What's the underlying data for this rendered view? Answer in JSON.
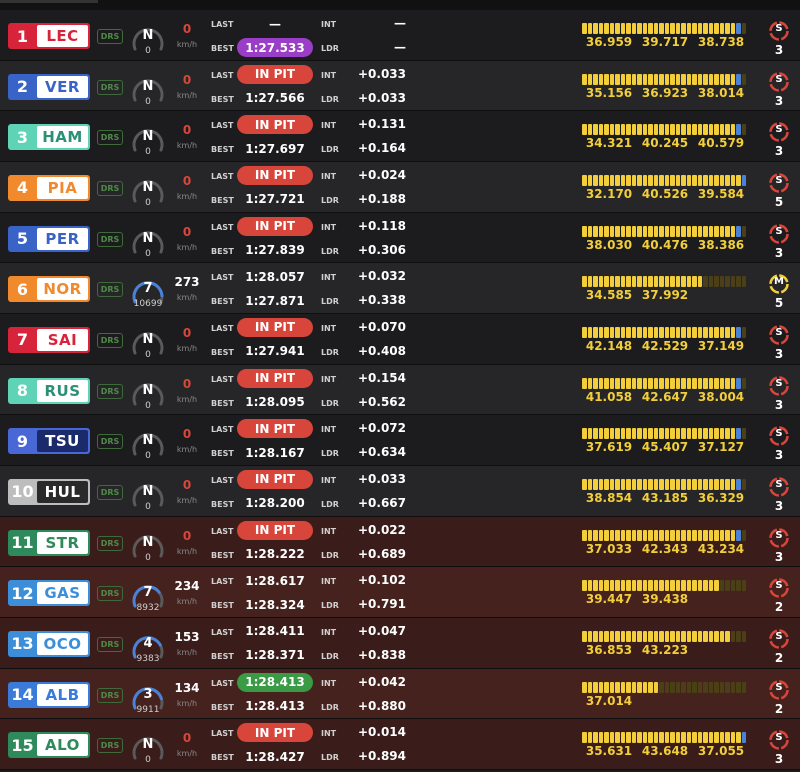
{
  "labels": {
    "drs": "DRS",
    "kmh": "km/h",
    "last": "LAST",
    "best": "BEST",
    "int": "INT",
    "ldr": "LDR"
  },
  "colors": {
    "yellow": "#f2cf3a",
    "yellow_dim": "#4a3f16",
    "blue": "#4a82d9",
    "grey_dim": "#3a3a3a",
    "pit": "#d8453a",
    "purple": "#9a3dc7",
    "green": "#3a9a45"
  },
  "drivers": [
    {
      "pos": "1",
      "code": "LEC",
      "team_color": "#d8243a",
      "code_text": "#d8243a",
      "gear": "N",
      "rpm": "0",
      "speed": "0",
      "last": "—",
      "last_style": "plain",
      "best": "1:27.533",
      "best_style": "purple",
      "int": "—",
      "ldr": "—",
      "minisector_progress": 0.97,
      "minisector_style": "yellow",
      "s1": "36.959",
      "s2": "39.717",
      "s3": "38.738",
      "tyre_compound": "S",
      "tyre_color": "#d8453a",
      "tyre_laps": "3",
      "zone": "normal"
    },
    {
      "pos": "2",
      "code": "VER",
      "team_color": "#3a63c7",
      "code_text": "#3a63c7",
      "gear": "N",
      "rpm": "0",
      "speed": "0",
      "last": "IN PIT",
      "last_style": "pit",
      "best": "1:27.566",
      "best_style": "plain",
      "int": "+0.033",
      "ldr": "+0.033",
      "minisector_progress": 0.97,
      "minisector_style": "yellow",
      "s1": "35.156",
      "s2": "36.923",
      "s3": "38.014",
      "tyre_compound": "S",
      "tyre_color": "#d8453a",
      "tyre_laps": "3",
      "zone": "normal"
    },
    {
      "pos": "3",
      "code": "HAM",
      "team_color": "#5ed3b6",
      "code_text": "#2c8f78",
      "gear": "N",
      "rpm": "0",
      "speed": "0",
      "last": "IN PIT",
      "last_style": "pit",
      "best": "1:27.697",
      "best_style": "plain",
      "int": "+0.131",
      "ldr": "+0.164",
      "minisector_progress": 0.97,
      "minisector_style": "yellow",
      "s1": "34.321",
      "s2": "40.245",
      "s3": "40.579",
      "tyre_compound": "S",
      "tyre_color": "#d8453a",
      "tyre_laps": "3",
      "zone": "normal"
    },
    {
      "pos": "4",
      "code": "PIA",
      "team_color": "#f08a2c",
      "code_text": "#f08a2c",
      "gear": "N",
      "rpm": "0",
      "speed": "0",
      "last": "IN PIT",
      "last_style": "pit",
      "best": "1:27.721",
      "best_style": "plain",
      "int": "+0.024",
      "ldr": "+0.188",
      "minisector_progress": 1.0,
      "minisector_style": "yellow",
      "s1": "32.170",
      "s2": "40.526",
      "s3": "39.584",
      "tyre_compound": "S",
      "tyre_color": "#d8453a",
      "tyre_laps": "5",
      "zone": "normal"
    },
    {
      "pos": "5",
      "code": "PER",
      "team_color": "#3a63c7",
      "code_text": "#3a63c7",
      "gear": "N",
      "rpm": "0",
      "speed": "0",
      "last": "IN PIT",
      "last_style": "pit",
      "best": "1:27.839",
      "best_style": "plain",
      "int": "+0.118",
      "ldr": "+0.306",
      "minisector_progress": 0.97,
      "minisector_style": "yellow",
      "s1": "38.030",
      "s2": "40.476",
      "s3": "38.386",
      "tyre_compound": "S",
      "tyre_color": "#d8453a",
      "tyre_laps": "3",
      "zone": "normal"
    },
    {
      "pos": "6",
      "code": "NOR",
      "team_color": "#f08a2c",
      "code_text": "#f08a2c",
      "gear": "7",
      "rpm": "10699",
      "speed": "273",
      "last": "1:28.057",
      "last_style": "plain",
      "best": "1:27.871",
      "best_style": "plain",
      "int": "+0.032",
      "ldr": "+0.338",
      "minisector_progress": 0.72,
      "minisector_style": "yellow",
      "s1": "34.585",
      "s2": "37.992",
      "s3": "",
      "tyre_compound": "M",
      "tyre_color": "#f2cf3a",
      "tyre_laps": "5",
      "zone": "normal"
    },
    {
      "pos": "7",
      "code": "SAI",
      "team_color": "#d8243a",
      "code_text": "#d8243a",
      "gear": "N",
      "rpm": "0",
      "speed": "0",
      "last": "IN PIT",
      "last_style": "pit",
      "best": "1:27.941",
      "best_style": "plain",
      "int": "+0.070",
      "ldr": "+0.408",
      "minisector_progress": 0.97,
      "minisector_style": "yellow",
      "s1": "42.148",
      "s2": "42.529",
      "s3": "37.149",
      "tyre_compound": "S",
      "tyre_color": "#d8453a",
      "tyre_laps": "3",
      "zone": "normal"
    },
    {
      "pos": "8",
      "code": "RUS",
      "team_color": "#5ed3b6",
      "code_text": "#2c8f78",
      "gear": "N",
      "rpm": "0",
      "speed": "0",
      "last": "IN PIT",
      "last_style": "pit",
      "best": "1:28.095",
      "best_style": "plain",
      "int": "+0.154",
      "ldr": "+0.562",
      "minisector_progress": 0.97,
      "minisector_style": "yellow",
      "s1": "41.058",
      "s2": "42.647",
      "s3": "38.004",
      "tyre_compound": "S",
      "tyre_color": "#d8453a",
      "tyre_laps": "3",
      "zone": "normal"
    },
    {
      "pos": "9",
      "code": "TSU",
      "team_color": "#4a67d6",
      "code_text": "#ffffff",
      "code_bg": "#1a2a6a",
      "gear": "N",
      "rpm": "0",
      "speed": "0",
      "last": "IN PIT",
      "last_style": "pit",
      "best": "1:28.167",
      "best_style": "plain",
      "int": "+0.072",
      "ldr": "+0.634",
      "minisector_progress": 0.97,
      "minisector_style": "yellow",
      "s1": "37.619",
      "s2": "45.407",
      "s3": "37.127",
      "tyre_compound": "S",
      "tyre_color": "#d8453a",
      "tyre_laps": "3",
      "zone": "normal"
    },
    {
      "pos": "10",
      "code": "HUL",
      "team_color": "#bdbdbd",
      "code_text": "#ffffff",
      "code_bg": "#2a2a2a",
      "gear": "N",
      "rpm": "0",
      "speed": "0",
      "last": "IN PIT",
      "last_style": "pit",
      "best": "1:28.200",
      "best_style": "plain",
      "int": "+0.033",
      "ldr": "+0.667",
      "minisector_progress": 0.97,
      "minisector_style": "yellow",
      "s1": "38.854",
      "s2": "43.185",
      "s3": "36.329",
      "tyre_compound": "S",
      "tyre_color": "#d8453a",
      "tyre_laps": "3",
      "zone": "normal"
    },
    {
      "pos": "11",
      "code": "STR",
      "team_color": "#2f8a5b",
      "code_text": "#2f8a5b",
      "gear": "N",
      "rpm": "0",
      "speed": "0",
      "last": "IN PIT",
      "last_style": "pit",
      "best": "1:28.222",
      "best_style": "plain",
      "int": "+0.022",
      "ldr": "+0.689",
      "minisector_progress": 0.97,
      "minisector_style": "yellow",
      "s1": "37.033",
      "s2": "42.343",
      "s3": "43.234",
      "tyre_compound": "S",
      "tyre_color": "#d8453a",
      "tyre_laps": "3",
      "zone": "red"
    },
    {
      "pos": "12",
      "code": "GAS",
      "team_color": "#3d8ed9",
      "code_text": "#3d8ed9",
      "gear": "7",
      "rpm": "8932",
      "speed": "234",
      "last": "1:28.617",
      "last_style": "plain",
      "best": "1:28.324",
      "best_style": "plain",
      "int": "+0.102",
      "ldr": "+0.791",
      "minisector_progress": 0.84,
      "minisector_style": "yellow",
      "s1": "39.447",
      "s2": "39.438",
      "s3": "",
      "tyre_compound": "S",
      "tyre_color": "#d8453a",
      "tyre_laps": "2",
      "zone": "red"
    },
    {
      "pos": "13",
      "code": "OCO",
      "team_color": "#3d8ed9",
      "code_text": "#3d8ed9",
      "gear": "4",
      "rpm": "9383",
      "speed": "153",
      "last": "1:28.411",
      "last_style": "plain",
      "best": "1:28.371",
      "best_style": "plain",
      "int": "+0.047",
      "ldr": "+0.838",
      "minisector_progress": 0.9,
      "minisector_style": "yellow",
      "s1": "36.853",
      "s2": "43.223",
      "s3": "",
      "tyre_compound": "S",
      "tyre_color": "#d8453a",
      "tyre_laps": "2",
      "zone": "red"
    },
    {
      "pos": "14",
      "code": "ALB",
      "team_color": "#3a7ad9",
      "code_text": "#3a7ad9",
      "gear": "3",
      "rpm": "9911",
      "speed": "134",
      "last": "1:28.413",
      "last_style": "green",
      "best": "1:28.413",
      "best_style": "plain",
      "int": "+0.042",
      "ldr": "+0.880",
      "minisector_progress": 0.47,
      "minisector_style": "yellow",
      "s1": "37.014",
      "s2": "",
      "s3": "",
      "tyre_compound": "S",
      "tyre_color": "#d8453a",
      "tyre_laps": "2",
      "zone": "red"
    },
    {
      "pos": "15",
      "code": "ALO",
      "team_color": "#2f8a5b",
      "code_text": "#2f8a5b",
      "gear": "N",
      "rpm": "0",
      "speed": "0",
      "last": "IN PIT",
      "last_style": "pit",
      "best": "1:28.427",
      "best_style": "plain",
      "int": "+0.014",
      "ldr": "+0.894",
      "minisector_progress": 1.0,
      "minisector_style": "yellow",
      "s1": "35.631",
      "s2": "43.648",
      "s3": "37.055",
      "tyre_compound": "S",
      "tyre_color": "#d8453a",
      "tyre_laps": "3",
      "zone": "red"
    }
  ]
}
